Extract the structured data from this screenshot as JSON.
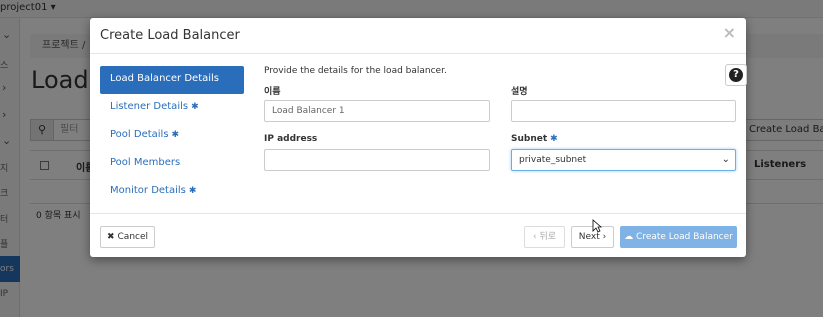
{
  "background": {
    "project": "project01",
    "breadcrumb": "프로젝트 /",
    "page_title": "Load",
    "filter_placeholder": "필터",
    "create_button": "Create Load Balancer",
    "table": {
      "col_name": "이름",
      "col_listeners": "Listeners"
    },
    "count_text": "0 항목 표시",
    "sidebar_fragments": [
      "스",
      "지",
      "크",
      "터",
      "플"
    ],
    "sidebar_active": "ors",
    "sidebar_ip": "IP"
  },
  "modal": {
    "title": "Create Load Balancer",
    "close_glyph": "×",
    "steps": [
      {
        "label": "Load Balancer Details",
        "required": false,
        "active": true
      },
      {
        "label": "Listener Details",
        "required": true,
        "active": false
      },
      {
        "label": "Pool Details",
        "required": true,
        "active": false
      },
      {
        "label": "Pool Members",
        "required": false,
        "active": false
      },
      {
        "label": "Monitor Details",
        "required": true,
        "active": false
      }
    ],
    "intro": "Provide the details for the load balancer.",
    "help_glyph": "?",
    "fields": {
      "name_label": "이름",
      "name_value": "Load Balancer 1",
      "description_label": "설명",
      "description_value": "",
      "ip_label": "IP address",
      "ip_value": "",
      "subnet_label": "Subnet",
      "subnet_value": "private_subnet"
    },
    "required_star": "✱",
    "footer": {
      "cancel": "Cancel",
      "back": "‹ 뒤로",
      "next": "Next ›",
      "create": "Create Load Balancer"
    }
  }
}
